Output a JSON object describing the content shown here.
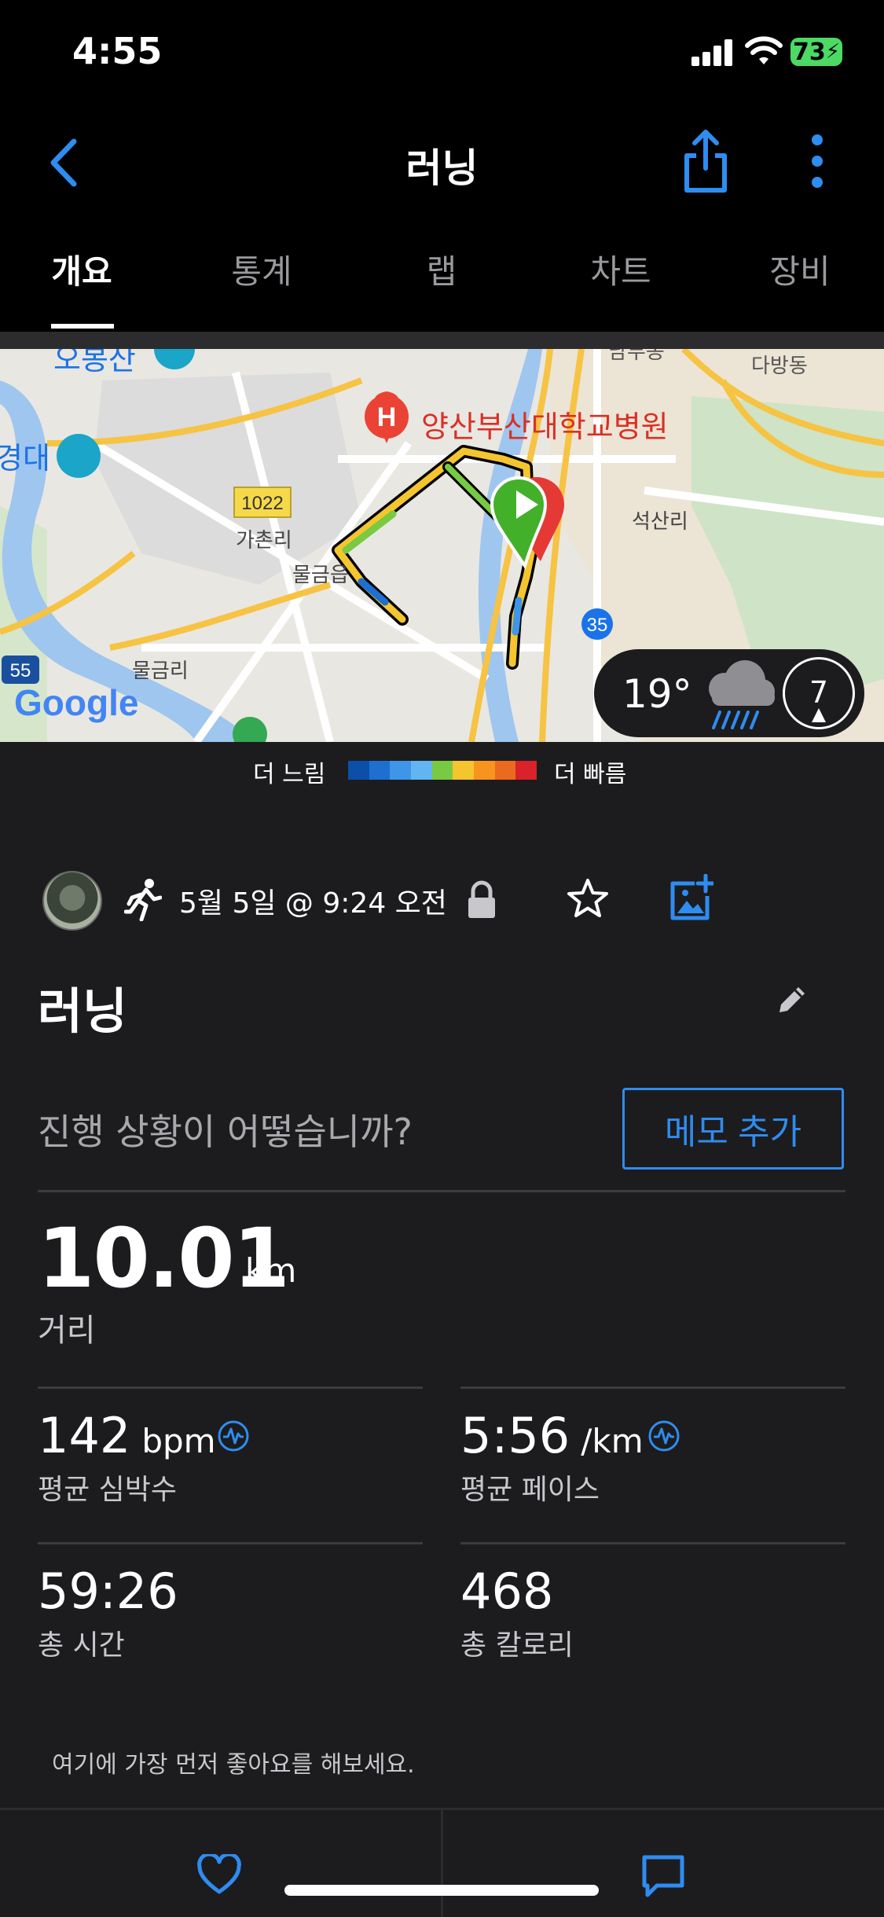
{
  "status_bar": {
    "time": "4:55",
    "battery": "73"
  },
  "header": {
    "title": "러닝"
  },
  "tabs": [
    {
      "label": "개요",
      "active": true
    },
    {
      "label": "통계"
    },
    {
      "label": "랩"
    },
    {
      "label": "차트"
    },
    {
      "label": "장비"
    }
  ],
  "map": {
    "labels": {
      "obongsan": "오봉산",
      "dabangdong": "다방동",
      "nambudong": "남부동",
      "hospital": "양산부산대학교병원",
      "road_1022": "1022",
      "gachonri": "가촌리",
      "mulgeumeup": "물금읍",
      "seoksanri": "석산리",
      "route_35": "35",
      "route_55": "55",
      "mulgeumri": "물금리",
      "daehak_left": "경대",
      "google": "Google",
      "hospital_marker": "H"
    }
  },
  "weather": {
    "temp": "19°",
    "wind": "7"
  },
  "legend": {
    "slow": "더 느림",
    "fast": "더 빠름",
    "colors": [
      "#0b4fa8",
      "#1f6fd0",
      "#3f95e8",
      "#62b5f0",
      "#7ac943",
      "#f4c52e",
      "#f7941d",
      "#ec6a1f",
      "#d9222a"
    ]
  },
  "activity": {
    "datetime": "5월 5일 @ 9:24 오전",
    "title": "러닝",
    "prompt": "진행 상황이 어떻습니까?",
    "memo_button": "메모 추가"
  },
  "stats": {
    "distance": {
      "value": "10.01",
      "unit": "km",
      "label": "거리"
    },
    "heart_rate": {
      "value": "142",
      "unit": "bpm",
      "label": "평균 심박수"
    },
    "pace": {
      "value": "5:56",
      "unit": "/km",
      "label": "평균 페이스"
    },
    "time": {
      "value": "59:26",
      "label": "총 시간"
    },
    "calories": {
      "value": "468",
      "label": "총 칼로리"
    }
  },
  "like_prompt": "여기에 가장 먼저 좋아요를 해보세요.",
  "colors": {
    "accent": "#2f8cf0",
    "background": "#1c1c1e",
    "topbar": "#000000"
  }
}
